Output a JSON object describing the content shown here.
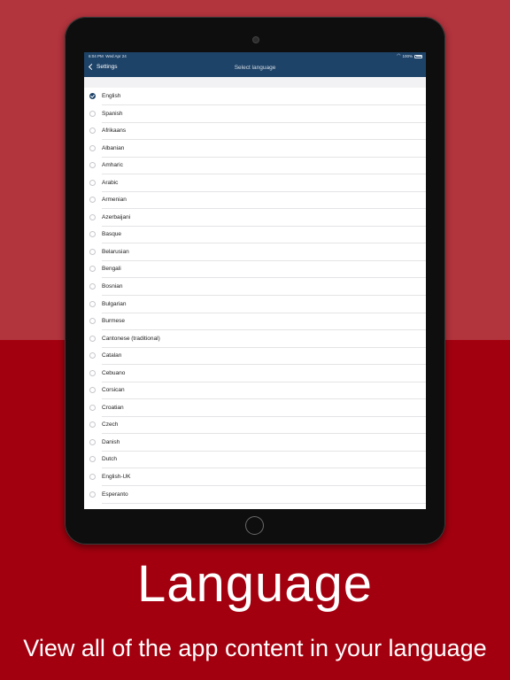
{
  "status_bar": {
    "time": "6:04 PM",
    "date": "Wed Apr 24",
    "battery": "100%"
  },
  "nav": {
    "back_label": "Settings",
    "title": "Select language"
  },
  "languages": [
    {
      "label": "English",
      "selected": true
    },
    {
      "label": "Spanish",
      "selected": false
    },
    {
      "label": "Afrikaans",
      "selected": false
    },
    {
      "label": "Albanian",
      "selected": false
    },
    {
      "label": "Amharic",
      "selected": false
    },
    {
      "label": "Arabic",
      "selected": false
    },
    {
      "label": "Armenian",
      "selected": false
    },
    {
      "label": "Azerbaijani",
      "selected": false
    },
    {
      "label": "Basque",
      "selected": false
    },
    {
      "label": "Belarusian",
      "selected": false
    },
    {
      "label": "Bengali",
      "selected": false
    },
    {
      "label": "Bosnian",
      "selected": false
    },
    {
      "label": "Bulgarian",
      "selected": false
    },
    {
      "label": "Burmese",
      "selected": false
    },
    {
      "label": "Cantonese (traditional)",
      "selected": false
    },
    {
      "label": "Catalan",
      "selected": false
    },
    {
      "label": "Cebuano",
      "selected": false
    },
    {
      "label": "Corsican",
      "selected": false
    },
    {
      "label": "Croatian",
      "selected": false
    },
    {
      "label": "Czech",
      "selected": false
    },
    {
      "label": "Danish",
      "selected": false
    },
    {
      "label": "Dutch",
      "selected": false
    },
    {
      "label": "English-UK",
      "selected": false
    },
    {
      "label": "Esperanto",
      "selected": false
    }
  ],
  "promo": {
    "headline": "Language",
    "subline": "View all of the app content in your language"
  },
  "colors": {
    "background_top": "#b2343d",
    "background_bottom": "#a3000f",
    "nav_bar": "#1e4368"
  }
}
